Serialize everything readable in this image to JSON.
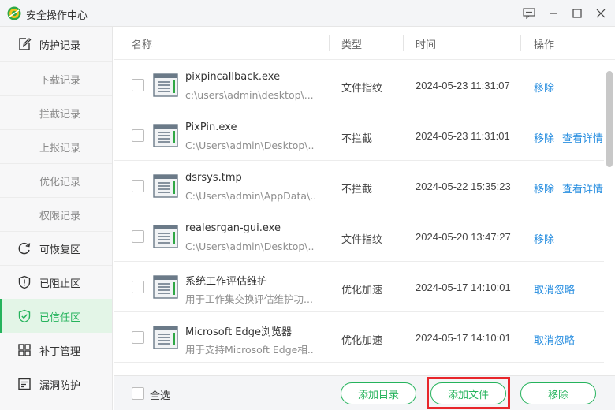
{
  "app": {
    "title": "安全操作中心",
    "logo_icon": "360-logo-icon",
    "window_controls": [
      "feedback-icon",
      "minimize-icon",
      "maximize-icon",
      "close-icon"
    ]
  },
  "colors": {
    "accent": "#25b35c",
    "link": "#2a8fe0",
    "active_bg": "#e3f5e7",
    "highlight": "#e8262b"
  },
  "sidebar": {
    "items": [
      {
        "label": "防护记录",
        "icon": "edit-note-icon",
        "type": "main"
      },
      {
        "label": "下载记录",
        "type": "sub"
      },
      {
        "label": "拦截记录",
        "type": "sub"
      },
      {
        "label": "上报记录",
        "type": "sub"
      },
      {
        "label": "优化记录",
        "type": "sub"
      },
      {
        "label": "权限记录",
        "type": "sub"
      },
      {
        "label": "可恢复区",
        "icon": "restore-icon",
        "type": "main"
      },
      {
        "label": "已阻止区",
        "icon": "shield-blocked-icon",
        "type": "main"
      },
      {
        "label": "已信任区",
        "icon": "shield-check-icon",
        "type": "main",
        "active": true
      },
      {
        "label": "补丁管理",
        "icon": "grid-icon",
        "type": "main"
      },
      {
        "label": "漏洞防护",
        "icon": "vulnerability-icon",
        "type": "main"
      }
    ]
  },
  "table": {
    "headers": {
      "name": "名称",
      "type": "类型",
      "time": "时间",
      "action": "操作"
    },
    "rows": [
      {
        "name": "pixpincallback.exe",
        "path": "c:\\users\\admin\\desktop\\...",
        "type": "文件指纹",
        "time": "2024-05-23 11:31:07",
        "actions": [
          "移除"
        ]
      },
      {
        "name": "PixPin.exe",
        "path": "C:\\Users\\admin\\Desktop\\...",
        "type": "不拦截",
        "time": "2024-05-23 11:31:01",
        "actions": [
          "移除",
          "查看详情"
        ]
      },
      {
        "name": "dsrsys.tmp",
        "path": "C:\\Users\\admin\\AppData\\...",
        "type": "不拦截",
        "time": "2024-05-22 15:35:23",
        "actions": [
          "移除",
          "查看详情"
        ]
      },
      {
        "name": "realesrgan-gui.exe",
        "path": "C:\\Users\\admin\\Desktop\\...",
        "type": "文件指纹",
        "time": "2024-05-20 13:47:27",
        "actions": [
          "移除"
        ]
      },
      {
        "name": "系统工作评估维护",
        "path": "用于工作集交换评估维护功...",
        "type": "优化加速",
        "time": "2024-05-17 14:10:01",
        "actions": [
          "取消忽略"
        ]
      },
      {
        "name": "Microsoft Edge浏览器",
        "path": "用于支持Microsoft Edge相...",
        "type": "优化加速",
        "time": "2024-05-17 14:10:01",
        "actions": [
          "取消忽略"
        ]
      }
    ]
  },
  "footer": {
    "select_all_label": "全选",
    "add_dir_label": "添加目录",
    "add_file_label": "添加文件",
    "remove_label": "移除"
  }
}
